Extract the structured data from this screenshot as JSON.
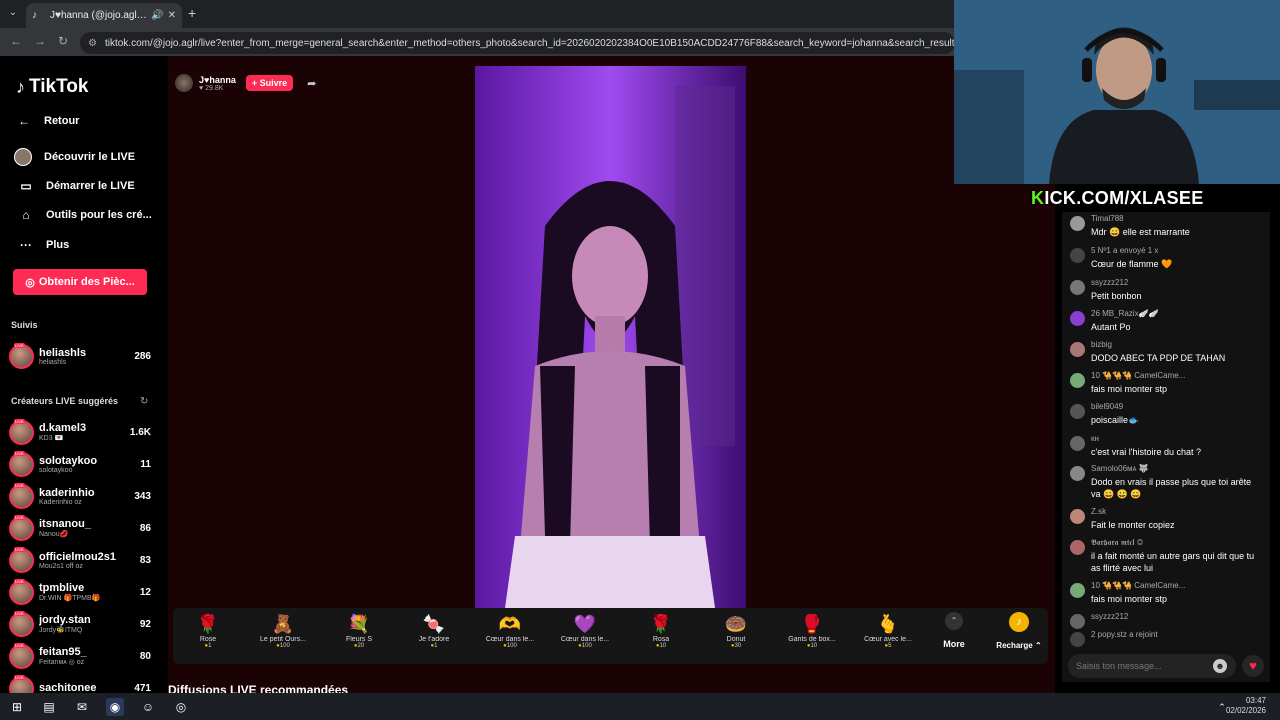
{
  "browser": {
    "tab_title": "J♥hanna (@jojo.aglr) est e",
    "new_tab": "+",
    "url": "tiktok.com/@jojo.aglr/live?enter_from_merge=general_search&enter_method=others_photo&search_id=2026020202384O0E10B150ACDD24776F88&search_keyword=johanna&search_result_id=7462385592"
  },
  "sidebar": {
    "logo": "TikTok",
    "back": "Retour",
    "menu": [
      {
        "label": "Découvrir le LIVE",
        "icon": "avatar-icon"
      },
      {
        "label": "Démarrer le LIVE",
        "icon": "camera-icon"
      },
      {
        "label": "Outils pour les cré...",
        "icon": "home-icon"
      },
      {
        "label": "Plus",
        "icon": "more-icon"
      }
    ],
    "coins_button": "Obtenir des Pièc...",
    "followed_title": "Suivis",
    "followed": [
      {
        "name": "heliashls",
        "sub": "heliashls",
        "count": "286"
      }
    ],
    "suggested_title": "Créateurs LIVE suggérés",
    "suggested": [
      {
        "name": "d.kamel3",
        "sub": "KD3 💌",
        "count": "1.6K"
      },
      {
        "name": "solotaykoo",
        "sub": "solotaykoo",
        "count": "11"
      },
      {
        "name": "kaderinhio",
        "sub": "Kaderinhio oz",
        "count": "343"
      },
      {
        "name": "itsnanou_",
        "sub": "Nanou💋",
        "count": "86"
      },
      {
        "name": "officielmou2s1",
        "sub": "Mou2s1 off oz",
        "count": "83"
      },
      {
        "name": "tpmblive",
        "sub": "Dr.WIN 🎁TPMB🎁",
        "count": "12"
      },
      {
        "name": "jordy.stan",
        "sub": "Jordy🐝ITMQ",
        "count": "92"
      },
      {
        "name": "feitan95_",
        "sub": "Feitanᴍᴀ ◎ oz",
        "count": "80"
      },
      {
        "name": "sachitonee",
        "sub": "",
        "count": "471"
      }
    ]
  },
  "host": {
    "name": "J♥hanna",
    "likes": "♥ 29.8K",
    "follow": "+ Suivre"
  },
  "gifts": [
    {
      "name": "Rose",
      "price": "1",
      "icon": "🌹"
    },
    {
      "name": "Le petit Ours...",
      "price": "100",
      "icon": "🧸"
    },
    {
      "name": "Fleurs S",
      "price": "20",
      "icon": "💐"
    },
    {
      "name": "Je t'adore",
      "price": "1",
      "icon": "🍬"
    },
    {
      "name": "Cœur dans le...",
      "price": "100",
      "icon": "🫶"
    },
    {
      "name": "Cœur dans le...",
      "price": "100",
      "icon": "💜"
    },
    {
      "name": "Rosa",
      "price": "10",
      "icon": "🌹"
    },
    {
      "name": "Donut",
      "price": "30",
      "icon": "🍩"
    },
    {
      "name": "Gants de box...",
      "price": "10",
      "icon": "🥊"
    },
    {
      "name": "Cœur avec le...",
      "price": "5",
      "icon": "🫰"
    }
  ],
  "more": "More",
  "recharge": "Recharge ⌃",
  "recommended": "Diffusions LIVE recommandées",
  "overlay": {
    "kick": "KICK.COM/XLASEE"
  },
  "chat": {
    "messages": [
      {
        "user": "Timal788",
        "text": "Mdr 😀 elle est marrante"
      },
      {
        "user": "5  Nº1  a envoyé 1 x",
        "text": "Cœur de flamme 🧡"
      },
      {
        "user": "ssyzzz212",
        "text": "Petit bonbon"
      },
      {
        "user": "26  MB_Razix🪽🪽",
        "text": "Autant Po"
      },
      {
        "user": "bizbig",
        "text": "DODO ABEC TA PDP DE TAHAN"
      },
      {
        "user": "10  🐪🐪🐪 CamelCame...",
        "text": "fais moi monter stp"
      },
      {
        "user": "bilel9049",
        "text": "poiscaille🐟"
      },
      {
        "user": "кн",
        "text": "c'est vrai l'histoire du chat ?"
      },
      {
        "user": "Samolo06ᴍᴀ 🐺",
        "text": "Dodo en vrais il passe plus que toi arête va 😀 😀 😀"
      },
      {
        "user": "Z.sk",
        "text": "Fait le monter copiez"
      },
      {
        "user": "𝕭𝖆𝖗𝖇𝖆𝖗𝖆 𝖒𝖙𝖈𝖑 ◎",
        "text": "il a fait monté un autre gars qui dit que tu as flirté avec lui"
      },
      {
        "user": "10  🐪🐪🐪 CamelCame...",
        "text": "fais moi monter stp"
      },
      {
        "user": "ssyzzz212",
        "text": ""
      },
      {
        "user": "2  popy.stz  a rejoint",
        "text": ""
      }
    ],
    "input_placeholder": "Saisis ton message..."
  },
  "taskbar": {
    "time": "03:47",
    "date": "02/02/2026"
  },
  "colors": {
    "accent": "#fe2c55",
    "kick_green": "#53fc18"
  }
}
